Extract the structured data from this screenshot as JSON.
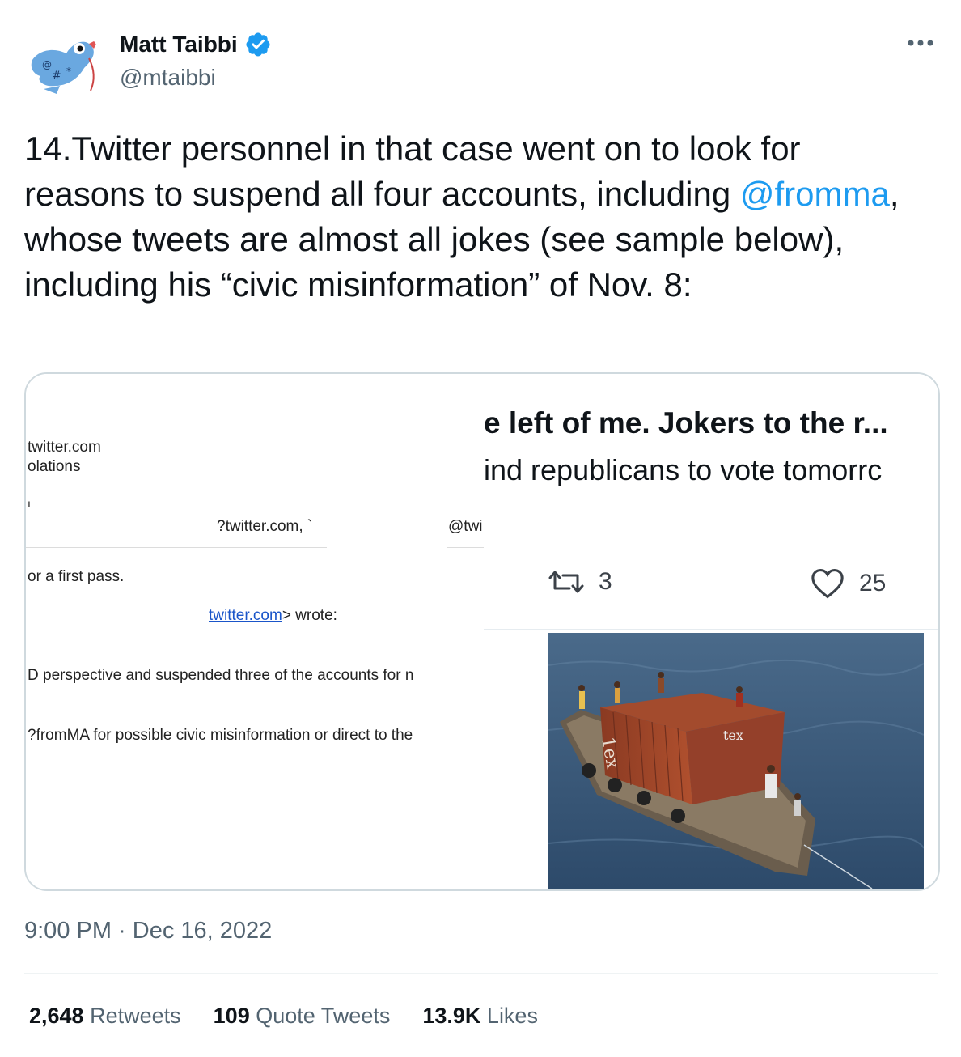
{
  "author": {
    "name": "Matt Taibbi",
    "handle": "@mtaibbi"
  },
  "tweet": {
    "text_before_mention": "14.Twitter personnel in that case went on to look for reasons to suspend all four accounts, including ",
    "mention": "@fromma",
    "text_after_mention": ", whose tweets are almost all jokes (see sample below), including his “civic misinformation” of Nov. 8:"
  },
  "media": {
    "email": {
      "line1": "twitter.com",
      "line2": "olations",
      "line3": "ı",
      "line4a": "?twitter.com, `",
      "line4b": "@twi",
      "line5": "or a first pass.",
      "line6_link": "twitter.com",
      "line6_rest": "> wrote:",
      "line7": "D perspective and suspended three of the accounts for n",
      "line8": "?fromMA for possible civic misinformation or direct to the"
    },
    "embedded_tweet": {
      "line1": "e left of me. Jokers to the r...",
      "line2": "ind republicans to vote tomorrc",
      "retweets": "3",
      "likes": "25"
    },
    "photo_text": {
      "container_mark": "tex",
      "container_side": "1ex"
    }
  },
  "timestamp": "9:00 PM · Dec 16, 2022",
  "stats": {
    "retweets_count": "2,648",
    "retweets_label": "Retweets",
    "quotes_count": "109",
    "quotes_label": "Quote Tweets",
    "likes_count": "13.9K",
    "likes_label": "Likes"
  },
  "colors": {
    "accent": "#1d9bf0",
    "text": "#0f1419",
    "muted": "#536471"
  },
  "icons": [
    "avatar-bird-icon",
    "verified-badge-icon",
    "more-options-icon",
    "retweet-icon",
    "heart-icon"
  ]
}
